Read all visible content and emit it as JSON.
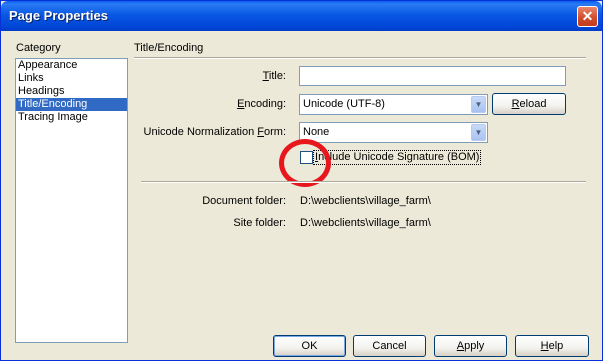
{
  "window": {
    "title": "Page Properties",
    "close_glyph": "✕"
  },
  "category": {
    "label": "Category",
    "items": [
      "Appearance",
      "Links",
      "Headings",
      "Title/Encoding",
      "Tracing Image"
    ],
    "selected": "Title/Encoding"
  },
  "section": {
    "title": "Title/Encoding"
  },
  "form": {
    "title": {
      "label": "Title:",
      "value": ""
    },
    "encoding": {
      "label": "Encoding:",
      "value": "Unicode (UTF-8)"
    },
    "reload_label": "Reload",
    "normalization": {
      "label": "Unicode Normalization Form:",
      "value": "None"
    },
    "bom": {
      "label": "Include Unicode Signature (BOM)",
      "checked": false
    }
  },
  "info": {
    "document_folder_label": "Document folder:",
    "document_folder_value": "D:\\webclients\\village_farm\\",
    "site_folder_label": "Site folder:",
    "site_folder_value": "D:\\webclients\\village_farm\\"
  },
  "buttons": {
    "ok": "OK",
    "cancel": "Cancel",
    "apply": "Apply",
    "help": "Help"
  },
  "annotation_color": "#e8171d"
}
